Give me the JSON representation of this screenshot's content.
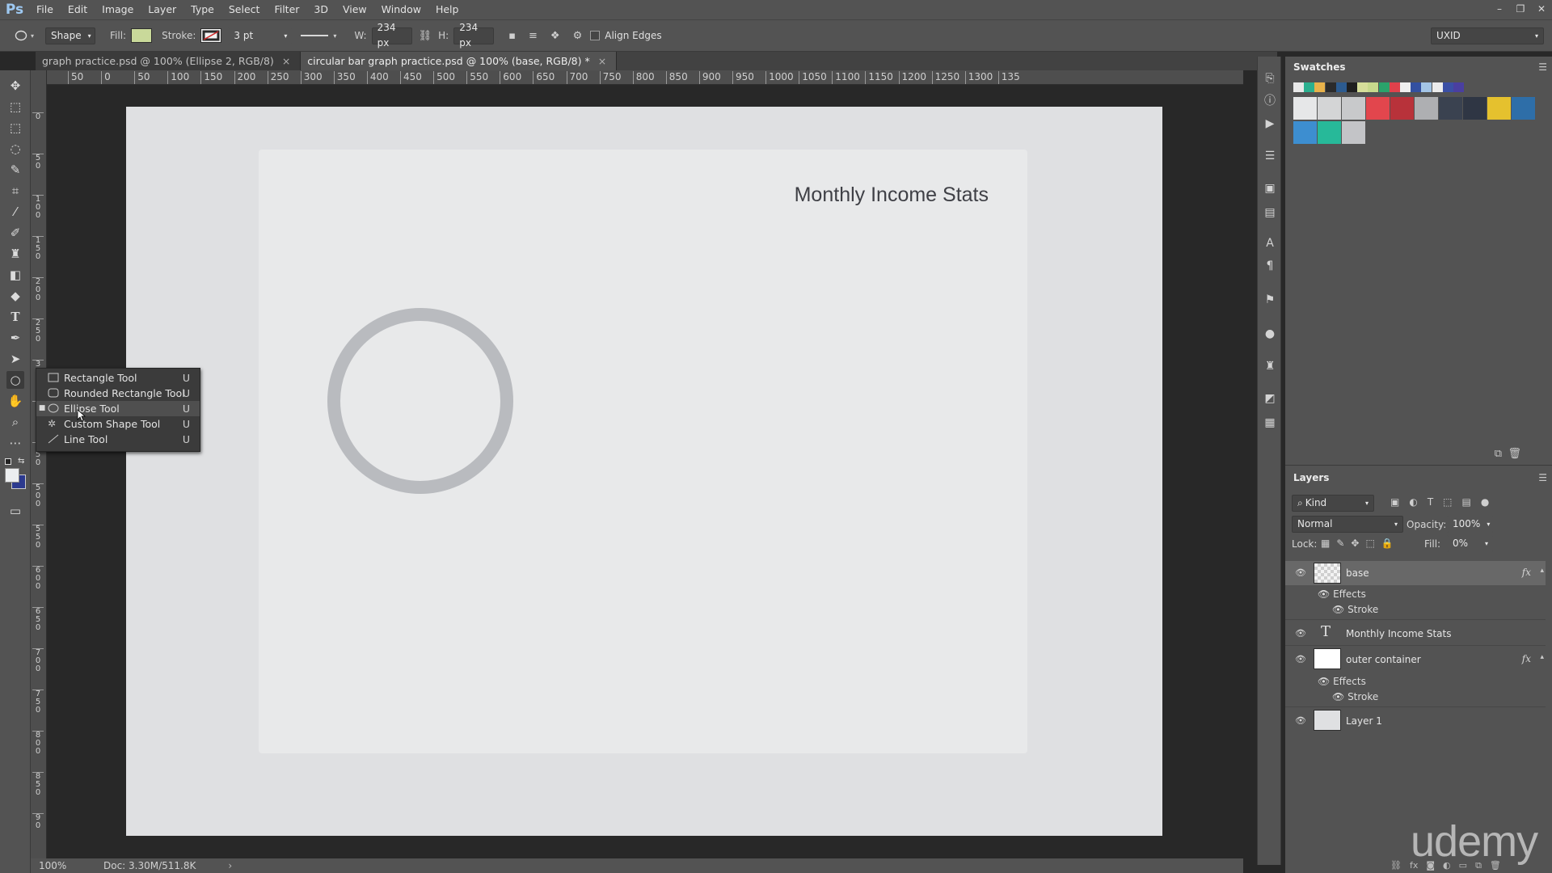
{
  "app": {
    "logo": "Ps"
  },
  "menu": [
    "File",
    "Edit",
    "Image",
    "Layer",
    "Type",
    "Select",
    "Filter",
    "3D",
    "View",
    "Window",
    "Help"
  ],
  "window_controls": [
    "–",
    "❐",
    "✕"
  ],
  "options_bar": {
    "mode": "Shape",
    "fill_label": "Fill:",
    "fill_color": "#c9d99a",
    "stroke_label": "Stroke:",
    "stroke_width": "3 pt",
    "w_label": "W:",
    "w_value": "234 px",
    "h_label": "H:",
    "h_value": "234 px",
    "align_edges_label": "Align Edges",
    "align_edges_checked": false,
    "workspace": "UXID"
  },
  "tabs": [
    {
      "label": "graph practice.psd @ 100% (Ellipse 2, RGB/8)",
      "active": false
    },
    {
      "label": "circular bar graph practice.psd @ 100% (base, RGB/8) *",
      "active": true
    }
  ],
  "ruler": {
    "top": [
      "50",
      "0",
      "50",
      "100",
      "150",
      "200",
      "250",
      "300",
      "350",
      "400",
      "450",
      "500",
      "550",
      "600",
      "650",
      "700",
      "750",
      "800",
      "850",
      "900",
      "950",
      "1000",
      "1050",
      "1100",
      "1150",
      "1200",
      "1250",
      "1300",
      "135"
    ],
    "left": [
      "0",
      "5 0",
      "1 0 0",
      "1 5 0",
      "2 0 0",
      "2 5 0",
      "3",
      "0",
      "4 5 0",
      "5 0 0",
      "5 5 0",
      "6 0 0",
      "6 5 0",
      "7 0 0",
      "7 5 0",
      "8 0 0",
      "8 5 0",
      "9 0"
    ]
  },
  "canvas": {
    "card_title": "Monthly Income Stats",
    "ring_color": "#b9bbbf"
  },
  "flyout": [
    {
      "label": "Rectangle Tool",
      "key": "U",
      "icon": "rectangle-icon",
      "selected": false
    },
    {
      "label": "Rounded Rectangle Tool",
      "key": "U",
      "icon": "rounded-rectangle-icon",
      "selected": false
    },
    {
      "label": "Ellipse Tool",
      "key": "U",
      "icon": "ellipse-icon",
      "selected": true
    },
    {
      "label": "Custom Shape Tool",
      "key": "U",
      "icon": "custom-shape-icon",
      "selected": false
    },
    {
      "label": "Line Tool",
      "key": "U",
      "icon": "line-icon",
      "selected": false
    }
  ],
  "status": {
    "zoom": "100%",
    "doc": "Doc: 3.30M/511.8K"
  },
  "swatches": {
    "title": "Swatches",
    "small": [
      "#e8e8e8",
      "#2bb08f",
      "#e8b24a",
      "#2b2b2b",
      "#2c5b8f",
      "#1f1f1f",
      "#d6de9a",
      "#c7d98c",
      "#2aa36b",
      "#e0414b",
      "#f0f0f0",
      "#3350a0",
      "#a4c5e6",
      "#ececec",
      "#3b4fa5",
      "#4a3fa0"
    ],
    "big": [
      "#e6e7e8",
      "#d4d5d6",
      "#c8c9cb",
      "#e2464d",
      "#b8323a",
      "#aeafb2",
      "#3a4250",
      "#2f3644",
      "#e5c12e",
      "#2e6ea8",
      "#3d8ed0",
      "#27b999",
      "#c3c4c7"
    ]
  },
  "layers": {
    "title": "Layers",
    "kind_label": "Kind",
    "blend_mode": "Normal",
    "opacity_label": "Opacity:",
    "opacity_value": "100%",
    "lock_label": "Lock:",
    "fill_label": "Fill:",
    "fill_value": "0%",
    "items": [
      {
        "name": "base",
        "type": "shape",
        "fx": "fx",
        "selected": true
      },
      {
        "name": "Monthly Income Stats",
        "type": "text"
      },
      {
        "name": "outer container",
        "type": "shape",
        "fx": "fx"
      },
      {
        "name": "Layer 1",
        "type": "pixel"
      }
    ],
    "effects_label": "Effects",
    "stroke_label": "Stroke"
  },
  "watermark": "udemy"
}
